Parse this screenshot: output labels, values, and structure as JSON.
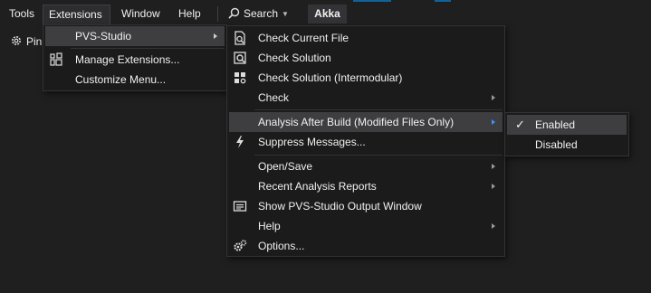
{
  "menubar": {
    "tools": "Tools",
    "extensions": "Extensions",
    "window": "Window",
    "help": "Help",
    "search": "Search",
    "solution": "Akka"
  },
  "toolbar": {
    "pin_label": "Pin"
  },
  "extensions_menu": {
    "items": [
      {
        "label": "PVS-Studio",
        "submenu": true
      },
      {
        "label": "Manage Extensions...",
        "icon": "manage-extensions-icon"
      },
      {
        "label": "Customize Menu..."
      }
    ]
  },
  "pvs_menu": {
    "items": [
      {
        "label": "Check Current File",
        "icon": "check-file-icon"
      },
      {
        "label": "Check Solution",
        "icon": "check-solution-icon"
      },
      {
        "label": "Check Solution (Intermodular)",
        "icon": "check-intermodular-icon"
      },
      {
        "label": "Check",
        "submenu": true
      },
      {
        "label": "Analysis After Build (Modified Files Only)",
        "submenu": true
      },
      {
        "label": "Suppress Messages...",
        "icon": "lightning-icon"
      },
      {
        "label": "Open/Save",
        "submenu": true
      },
      {
        "label": "Recent Analysis Reports",
        "submenu": true
      },
      {
        "label": "Show PVS-Studio Output Window",
        "icon": "output-window-icon"
      },
      {
        "label": "Help",
        "submenu": true
      },
      {
        "label": "Options...",
        "icon": "gears-icon"
      }
    ]
  },
  "analysis_submenu": {
    "items": [
      {
        "label": "Enabled",
        "checked": true
      },
      {
        "label": "Disabled",
        "checked": false
      }
    ]
  },
  "colors": {
    "background": "#1f1f1f",
    "menu_bg": "#1b1b1c",
    "highlight": "#3e3e40",
    "text": "#f1f1f1",
    "accent": "#0e639c"
  }
}
